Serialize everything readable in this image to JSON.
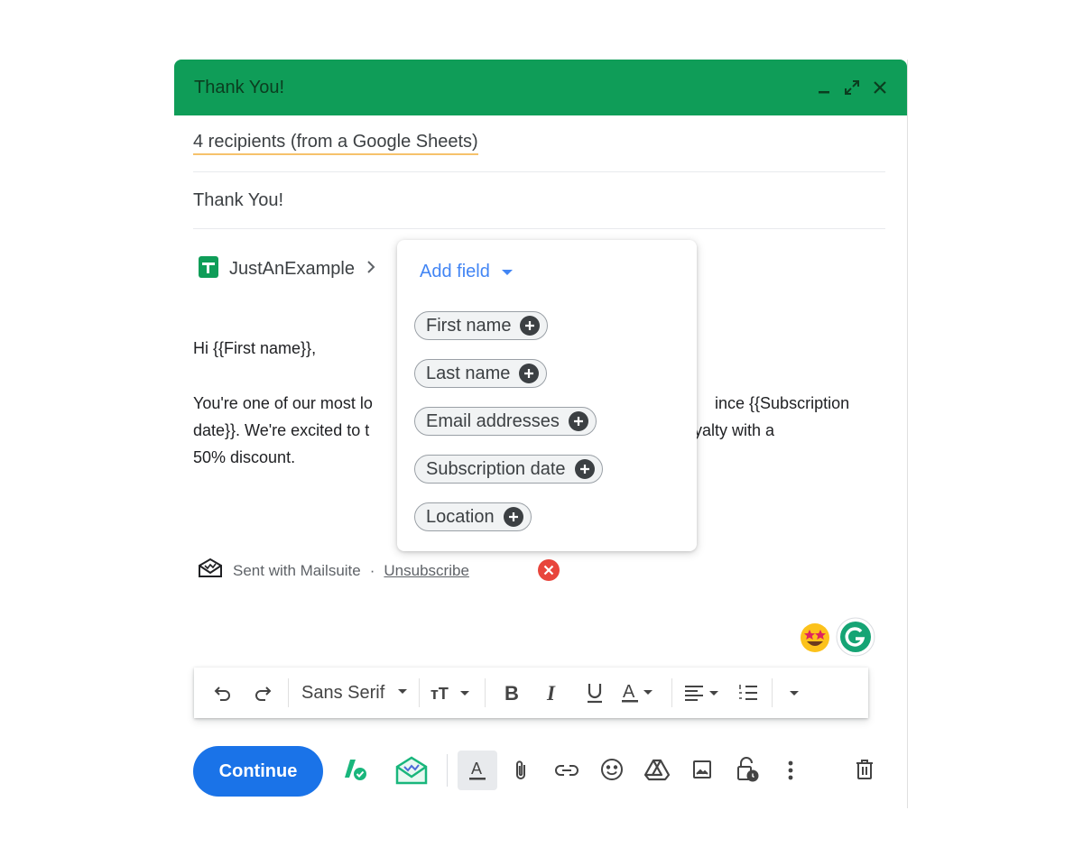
{
  "compose": {
    "title": "Thank You!",
    "recipients": "4 recipients (from a Google Sheets)",
    "subject": "Thank You!",
    "sheet_name": "JustAnExample",
    "body": {
      "greeting": "Hi {{First name}},",
      "line1": "You're one of our most lo",
      "line1_right": "ince {{Subscription",
      "line2": "date}}. We're excited to t",
      "line2_right": "yalty with a",
      "line3": "50% discount."
    },
    "signature": {
      "text": "Sent with Mailsuite",
      "separator": "·",
      "unsubscribe": "Unsubscribe"
    }
  },
  "format_bar": {
    "font_name": "Sans Serif"
  },
  "actions": {
    "continue_label": "Continue"
  },
  "dropdown": {
    "title": "Add field",
    "fields": [
      "First name",
      "Last name",
      "Email addresses",
      "Subscription date",
      "Location"
    ]
  },
  "colors": {
    "header": "#0f9d58",
    "accent": "#1a73e8",
    "add_field": "#4285f4",
    "mailsuite": "#19b67c"
  }
}
